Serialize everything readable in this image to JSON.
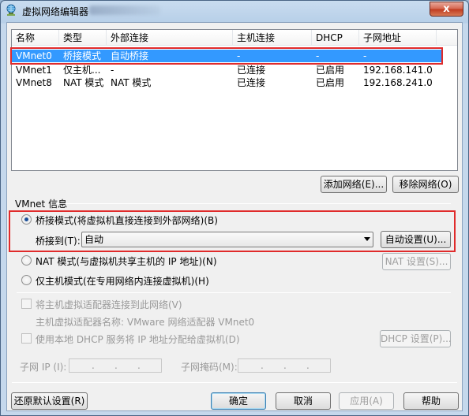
{
  "window": {
    "title": "虚拟网络编辑器",
    "close_label": "x",
    "blurred_title_suffix": "..."
  },
  "network_table": {
    "columns": [
      "名称",
      "类型",
      "外部连接",
      "主机连接",
      "DHCP",
      "子网地址"
    ],
    "rows": [
      {
        "name": "VMnet0",
        "type": "桥接模式",
        "external": "自动桥接",
        "host": "-",
        "dhcp": "-",
        "subnet": "-",
        "selected": true
      },
      {
        "name": "VMnet1",
        "type": "仅主机...",
        "external": "-",
        "host": "已连接",
        "dhcp": "已启用",
        "subnet": "192.168.141.0",
        "selected": false
      },
      {
        "name": "VMnet8",
        "type": "NAT 模式",
        "external": "NAT 模式",
        "host": "已连接",
        "dhcp": "已启用",
        "subnet": "192.168.241.0",
        "selected": false
      }
    ]
  },
  "list_buttons": {
    "add": "添加网络(E)...",
    "remove": "移除网络(O)"
  },
  "vmnet_info": {
    "section_label": "VMnet 信息",
    "bridged_radio": "桥接模式(将虚拟机直接连接到外部网络)(B)",
    "bridge_to_label": "桥接到(T):",
    "bridge_to_value": "自动",
    "auto_settings": "自动设置(U)...",
    "nat_radio": "NAT 模式(与虚拟机共享主机的 IP 地址)(N)",
    "nat_settings": "NAT 设置(S)...",
    "hostonly_radio": "仅主机模式(在专用网络内连接虚拟机)(H)",
    "connect_adapter": "将主机虚拟适配器连接到此网络(V)",
    "adapter_name": "主机虚拟适配器名称: VMware 网络适配器 VMnet0",
    "use_dhcp": "使用本地 DHCP 服务将 IP 地址分配给虚拟机(D)",
    "dhcp_settings": "DHCP 设置(P)...",
    "subnet_ip_label": "子网 IP (I):",
    "subnet_mask_label": "子网掩码(M):",
    "ip_dots": "."
  },
  "footer": {
    "restore_defaults": "还原默认设置(R)",
    "ok": "确定",
    "cancel": "取消",
    "apply": "应用(A)",
    "help": "帮助"
  }
}
